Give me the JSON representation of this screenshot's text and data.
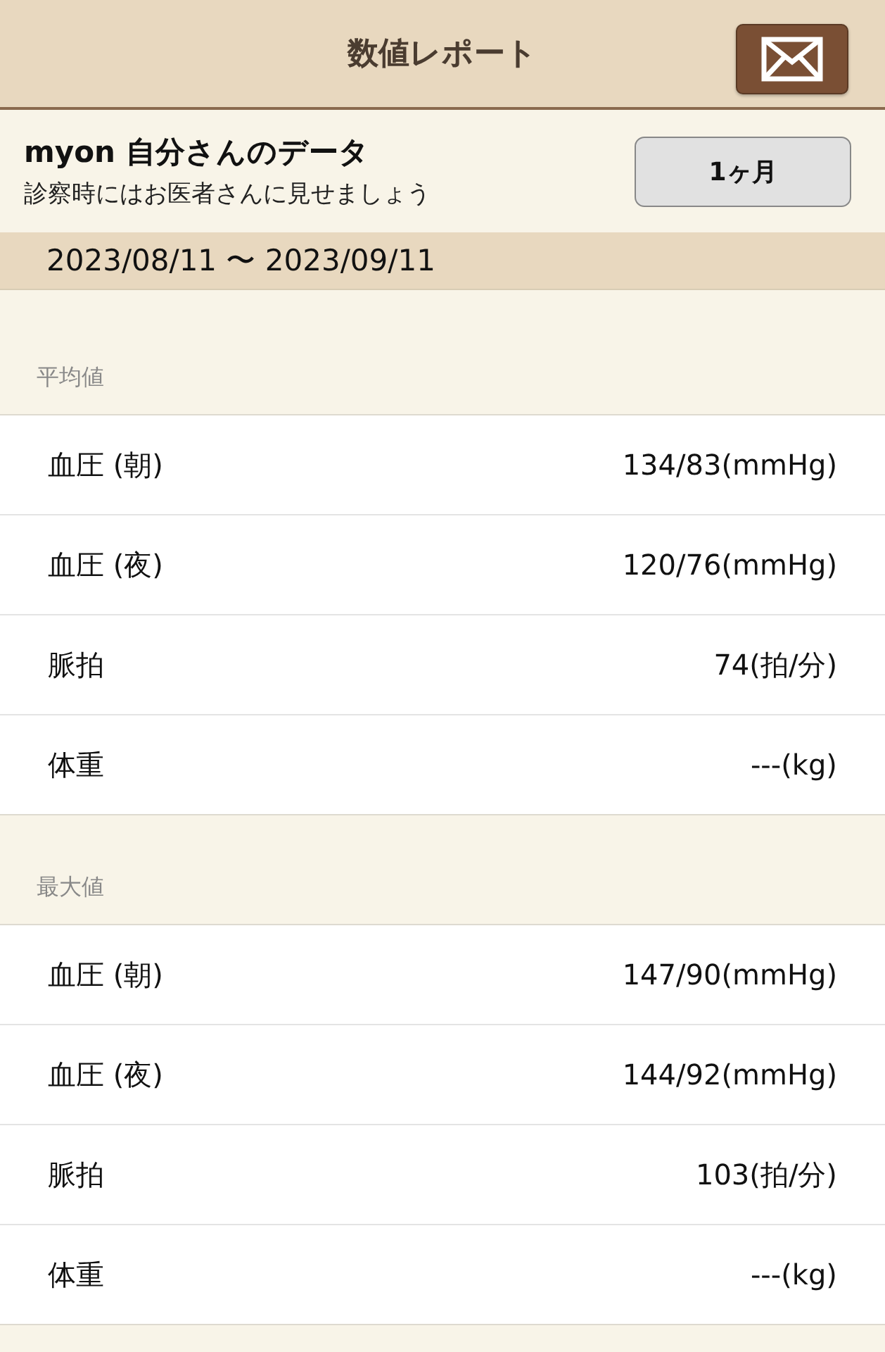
{
  "nav_bar": {
    "title": "数値レポート"
  },
  "header": {
    "title": "myon 自分さんのデータ",
    "subtitle": "診察時にはお医者さんに見せましょう",
    "period_button": "1ヶ月"
  },
  "date_range": "2023/08/11 〜 2023/09/11",
  "sections": [
    {
      "title": "平均値",
      "rows": [
        {
          "label": "血圧 (朝)",
          "value": "134/83(mmHg)"
        },
        {
          "label": "血圧 (夜)",
          "value": "120/76(mmHg)"
        },
        {
          "label": "脈拍",
          "value": "74(拍/分)"
        },
        {
          "label": "体重",
          "value": "---(kg)"
        }
      ]
    },
    {
      "title": "最大値",
      "rows": [
        {
          "label": "血圧 (朝)",
          "value": "147/90(mmHg)"
        },
        {
          "label": "血圧 (夜)",
          "value": "144/92(mmHg)"
        },
        {
          "label": "脈拍",
          "value": "103(拍/分)"
        },
        {
          "label": "体重",
          "value": "---(kg)"
        }
      ]
    }
  ]
}
